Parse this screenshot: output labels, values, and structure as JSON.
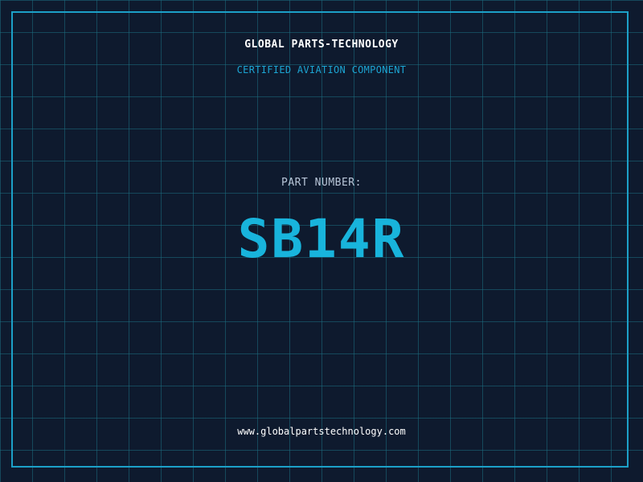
{
  "label": {
    "company_name": "GLOBAL PARTS-TECHNOLOGY",
    "tagline": "CERTIFIED AVIATION COMPONENT",
    "part_number_label": "PART NUMBER:",
    "part_number": "SB14R",
    "website": "www.globalpartstechnology.com"
  },
  "colors": {
    "background": "#0e1a2e",
    "grid": "#1c6e80",
    "accent": "#1ca6d4",
    "text_primary": "#ffffff",
    "text_secondary": "#b8c6d8"
  }
}
